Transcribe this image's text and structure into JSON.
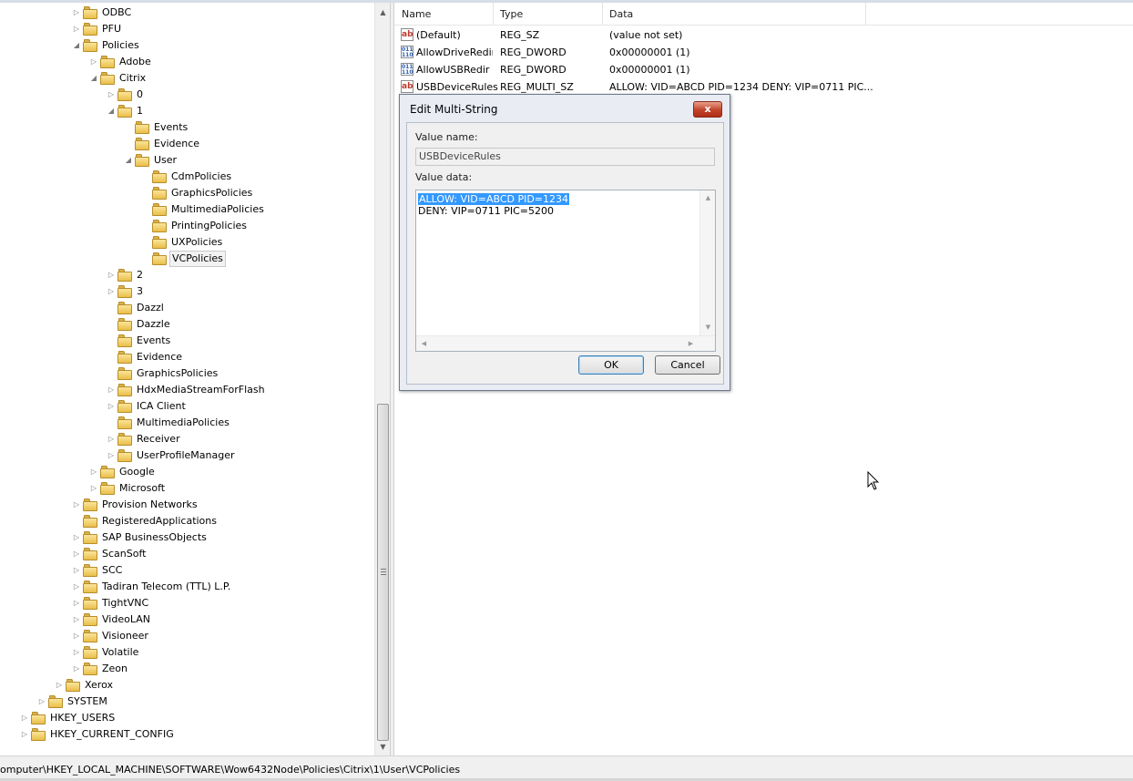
{
  "tree": {
    "items": [
      {
        "label": "ODBC",
        "level": 4,
        "expander": "collapsed"
      },
      {
        "label": "PFU",
        "level": 4,
        "expander": "collapsed"
      },
      {
        "label": "Policies",
        "level": 4,
        "expander": "expanded"
      },
      {
        "label": "Adobe",
        "level": 5,
        "expander": "collapsed"
      },
      {
        "label": "Citrix",
        "level": 5,
        "expander": "expanded"
      },
      {
        "label": "0",
        "level": 6,
        "expander": "collapsed"
      },
      {
        "label": "1",
        "level": 6,
        "expander": "expanded"
      },
      {
        "label": "Events",
        "level": 7,
        "expander": "none"
      },
      {
        "label": "Evidence",
        "level": 7,
        "expander": "none"
      },
      {
        "label": "User",
        "level": 7,
        "expander": "expanded"
      },
      {
        "label": "CdmPolicies",
        "level": 8,
        "expander": "none"
      },
      {
        "label": "GraphicsPolicies",
        "level": 8,
        "expander": "none"
      },
      {
        "label": "MultimediaPolicies",
        "level": 8,
        "expander": "none"
      },
      {
        "label": "PrintingPolicies",
        "level": 8,
        "expander": "none"
      },
      {
        "label": "UXPolicies",
        "level": 8,
        "expander": "none"
      },
      {
        "label": "VCPolicies",
        "level": 8,
        "expander": "none",
        "selected": true
      },
      {
        "label": "2",
        "level": 6,
        "expander": "collapsed"
      },
      {
        "label": "3",
        "level": 6,
        "expander": "collapsed"
      },
      {
        "label": "Dazzl",
        "level": 6,
        "expander": "none"
      },
      {
        "label": "Dazzle",
        "level": 6,
        "expander": "none"
      },
      {
        "label": "Events",
        "level": 6,
        "expander": "none"
      },
      {
        "label": "Evidence",
        "level": 6,
        "expander": "none"
      },
      {
        "label": "GraphicsPolicies",
        "level": 6,
        "expander": "none"
      },
      {
        "label": "HdxMediaStreamForFlash",
        "level": 6,
        "expander": "collapsed"
      },
      {
        "label": "ICA Client",
        "level": 6,
        "expander": "collapsed"
      },
      {
        "label": "MultimediaPolicies",
        "level": 6,
        "expander": "none"
      },
      {
        "label": "Receiver",
        "level": 6,
        "expander": "collapsed"
      },
      {
        "label": "UserProfileManager",
        "level": 6,
        "expander": "collapsed"
      },
      {
        "label": "Google",
        "level": 5,
        "expander": "collapsed"
      },
      {
        "label": "Microsoft",
        "level": 5,
        "expander": "collapsed"
      },
      {
        "label": "Provision Networks",
        "level": 4,
        "expander": "collapsed"
      },
      {
        "label": "RegisteredApplications",
        "level": 4,
        "expander": "none"
      },
      {
        "label": "SAP BusinessObjects",
        "level": 4,
        "expander": "collapsed"
      },
      {
        "label": "ScanSoft",
        "level": 4,
        "expander": "collapsed"
      },
      {
        "label": "SCC",
        "level": 4,
        "expander": "collapsed"
      },
      {
        "label": "Tadiran Telecom (TTL) L.P.",
        "level": 4,
        "expander": "collapsed"
      },
      {
        "label": "TightVNC",
        "level": 4,
        "expander": "collapsed"
      },
      {
        "label": "VideoLAN",
        "level": 4,
        "expander": "collapsed"
      },
      {
        "label": "Visioneer",
        "level": 4,
        "expander": "collapsed"
      },
      {
        "label": "Volatile",
        "level": 4,
        "expander": "collapsed"
      },
      {
        "label": "Zeon",
        "level": 4,
        "expander": "collapsed"
      },
      {
        "label": "Xerox",
        "level": 3,
        "expander": "collapsed"
      },
      {
        "label": "SYSTEM",
        "level": 2,
        "expander": "collapsed"
      },
      {
        "label": "HKEY_USERS",
        "level": 1,
        "expander": "collapsed"
      },
      {
        "label": "HKEY_CURRENT_CONFIG",
        "level": 1,
        "expander": "collapsed"
      }
    ]
  },
  "list": {
    "columns": [
      "Name",
      "Type",
      "Data"
    ],
    "rows": [
      {
        "icon": "string-value-icon",
        "name": "(Default)",
        "type": "REG_SZ",
        "data": "(value not set)"
      },
      {
        "icon": "dword-value-icon",
        "name": "AllowDriveRedir",
        "type": "REG_DWORD",
        "data": "0x00000001 (1)"
      },
      {
        "icon": "dword-value-icon",
        "name": "AllowUSBRedir",
        "type": "REG_DWORD",
        "data": "0x00000001 (1)"
      },
      {
        "icon": "string-value-icon",
        "name": "USBDeviceRules",
        "type": "REG_MULTI_SZ",
        "data": "ALLOW: VID=ABCD PID=1234 DENY: VIP=0711 PIC..."
      }
    ]
  },
  "dialog": {
    "title": "Edit Multi-String",
    "close_label": "x",
    "value_name_label": "Value name:",
    "value_name": "USBDeviceRules",
    "value_data_label": "Value data:",
    "value_data_lines": [
      "ALLOW: VID=ABCD PID=1234",
      "DENY: VIP=0711 PIC=5200"
    ],
    "ok_label": "OK",
    "cancel_label": "Cancel"
  },
  "status_bar": {
    "path": "omputer\\HKEY_LOCAL_MACHINE\\SOFTWARE\\Wow6432Node\\Policies\\Citrix\\1\\User\\VCPolicies"
  },
  "colors": {
    "selection": "#3399ff",
    "folder": "#e9bf4a",
    "close_button": "#c2432a"
  }
}
